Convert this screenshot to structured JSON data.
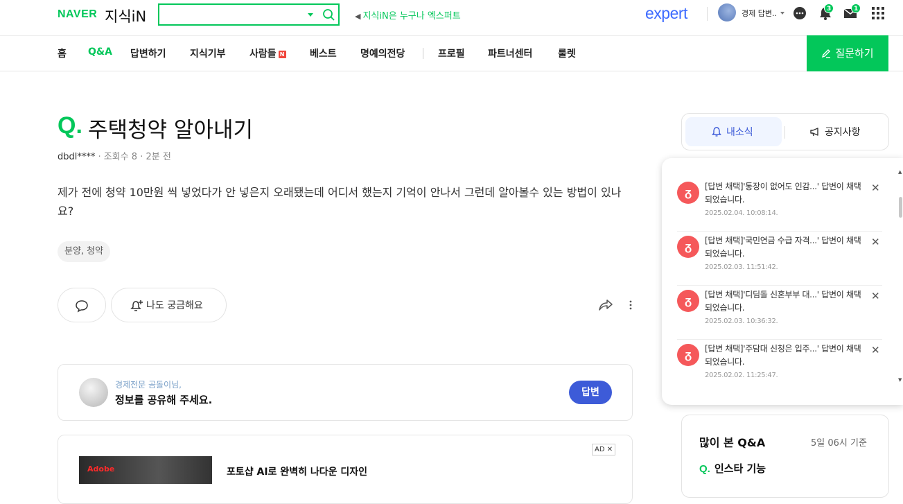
{
  "header": {
    "logo_naver": "NAVER",
    "logo_kin": "지식iN",
    "search_value": "",
    "promo_text": "지식iN은 누구나 엑스퍼트",
    "expert_logo": "expert",
    "user_name": "경제 답변..",
    "badges": {
      "notifications": "3",
      "messages": "1"
    },
    "icons": [
      "chat-icon",
      "bell-icon",
      "mail-icon",
      "apps-grid-icon"
    ]
  },
  "nav": {
    "items": [
      "홈",
      "Q&A",
      "답변하기",
      "지식기부",
      "사람들",
      "베스트",
      "명예의전당",
      "프로필",
      "파트너센터",
      "룰렛"
    ],
    "active": "Q&A",
    "new_badge": "N",
    "ask_button": "질문하기"
  },
  "question": {
    "q_mark": "Q.",
    "title": "주택청약 알아내기",
    "author": "dbdl****",
    "views": "조회수 8",
    "time": "2분 전",
    "body": "제가 전에 청약 10만원 씩 넣었다가 안 넣은지 오래됐는데 어디서 했는지 기억이 안나서 그런데 알아볼수 있는 방법이 있나요?",
    "tag": "분양, 청약",
    "curious_button": "나도 궁금해요"
  },
  "answer_prompt": {
    "subtitle": "경제전문 곰돌이님,",
    "main": "정보를 공유해 주세요.",
    "button": "답변"
  },
  "ad": {
    "badge": "AD",
    "brand": "Adobe",
    "title": "포토샵 AI로 완벽히 나다운 디자인"
  },
  "sidebar": {
    "tabs": [
      "내소식",
      "공지사항"
    ],
    "active_tab": "내소식",
    "notifications": [
      {
        "text": "[답변 채택]'통장이 없어도 인감...' 답변이 채택되었습니다.",
        "date": "2025.02.04. 10:08:14."
      },
      {
        "text": "[답변 채택]'국민연금 수급 자격...' 답변이 채택되었습니다.",
        "date": "2025.02.03. 11:51:42."
      },
      {
        "text": "[답변 채택]'디딤돌 신혼부부 대...' 답변이 채택되었습니다.",
        "date": "2025.02.03. 10:36:32."
      },
      {
        "text": "[답변 채택]'주담대 신청은 입주...' 답변이 채택되었습니다.",
        "date": "2025.02.02. 11:25:47."
      }
    ],
    "popular": {
      "title": "많이 본 Q&A",
      "time": "5일 06시 기준",
      "q_mark": "Q.",
      "first_item": "인스타 기능"
    }
  }
}
